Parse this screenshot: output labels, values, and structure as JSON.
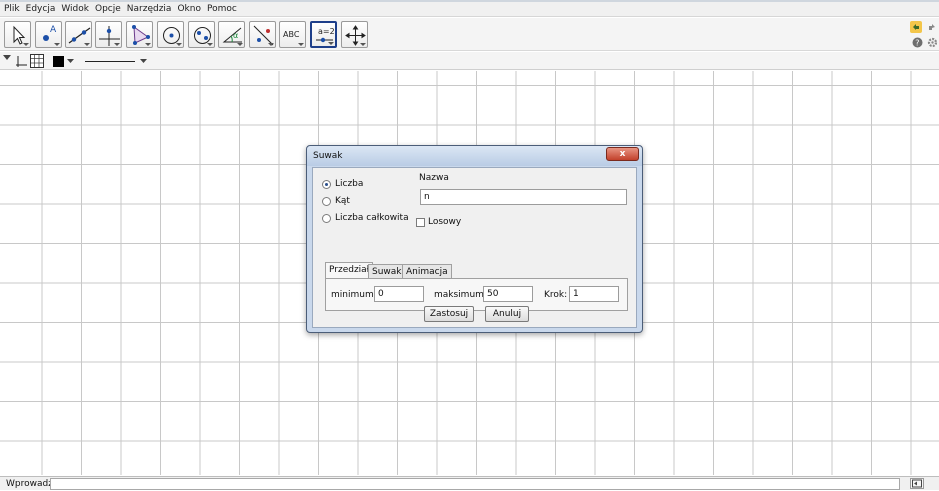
{
  "menu": [
    "Plik",
    "Edycja",
    "Widok",
    "Opcje",
    "Narzędzia",
    "Okno",
    "Pomoc"
  ],
  "toolbar": {
    "tools": [
      {
        "name": "move-tool",
        "icon": "arrow-pointer-icon"
      },
      {
        "name": "point-tool",
        "icon": "point-icon",
        "label": "A"
      },
      {
        "name": "line-tool",
        "icon": "line-icon"
      },
      {
        "name": "perpendicular-tool",
        "icon": "perpendicular-icon"
      },
      {
        "name": "polygon-tool",
        "icon": "polygon-icon"
      },
      {
        "name": "circle-tool",
        "icon": "circle-icon"
      },
      {
        "name": "ellipse-tool",
        "icon": "ellipse-icon"
      },
      {
        "name": "angle-tool",
        "icon": "angle-icon",
        "label": "α"
      },
      {
        "name": "reflect-tool",
        "icon": "reflect-icon"
      },
      {
        "name": "text-tool",
        "icon": "text-icon",
        "label": "ABC"
      },
      {
        "name": "slider-tool",
        "icon": "slider-icon",
        "label": "a=2"
      },
      {
        "name": "move-view-tool",
        "icon": "move-view-icon"
      }
    ],
    "active_tool": "slider-tool"
  },
  "stylebar": {
    "color": "#000000"
  },
  "dialog": {
    "title": "Suwak",
    "close_label": "x",
    "radios": [
      {
        "label": "Liczba",
        "checked": true
      },
      {
        "label": "Kąt",
        "checked": false
      },
      {
        "label": "Liczba całkowita",
        "checked": false
      }
    ],
    "name_label": "Nazwa",
    "name_value": "n",
    "random_label": "Losowy",
    "tabs": [
      "Przedział",
      "Suwak",
      "Animacja"
    ],
    "selected_tab": "Przedział",
    "min_label": "minimum:",
    "min_value": "0",
    "max_label": "maksimum:",
    "max_value": "50",
    "step_label": "Krok:",
    "step_value": "1",
    "apply_label": "Zastosuj",
    "cancel_label": "Anuluj"
  },
  "inputbar": {
    "label": "Wprowadź:",
    "value": ""
  }
}
